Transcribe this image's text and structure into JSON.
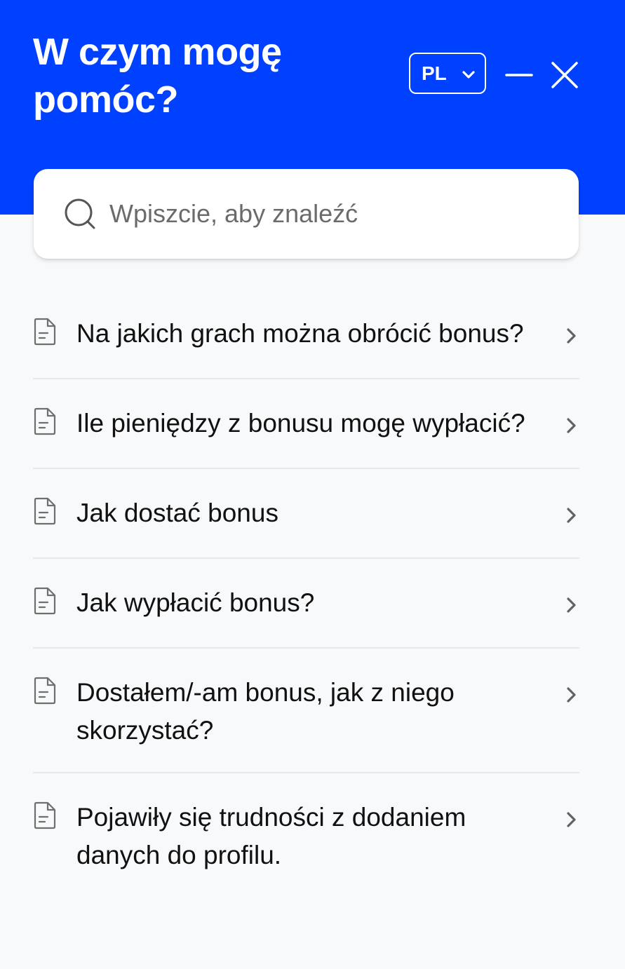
{
  "header": {
    "title": "W czym mogę pomóc?",
    "background_color": "#0040ff",
    "language": {
      "selected": "PL",
      "chevron_icon": "chevron-down-icon"
    },
    "minimize_icon": "minimize-icon",
    "close_icon": "close-icon"
  },
  "search": {
    "placeholder": "Wpiszcie, aby znaleźć",
    "value": "",
    "icon": "search-icon"
  },
  "articles": [
    {
      "label": "Na jakich grach można obrócić bonus?",
      "icon": "document-icon"
    },
    {
      "label": "Ile pieniędzy z bonusu mogę wypłacić?",
      "icon": "document-icon"
    },
    {
      "label": "Jak dostać bonus",
      "icon": "document-icon"
    },
    {
      "label": "Jak wypłacić bonus?",
      "icon": "document-icon"
    },
    {
      "label": "Dostałem/-am bonus, jak z niego skorzystać?",
      "icon": "document-icon"
    },
    {
      "label": "Pojawiły się trudności z dodaniem danych do profilu.",
      "icon": "document-icon"
    }
  ]
}
